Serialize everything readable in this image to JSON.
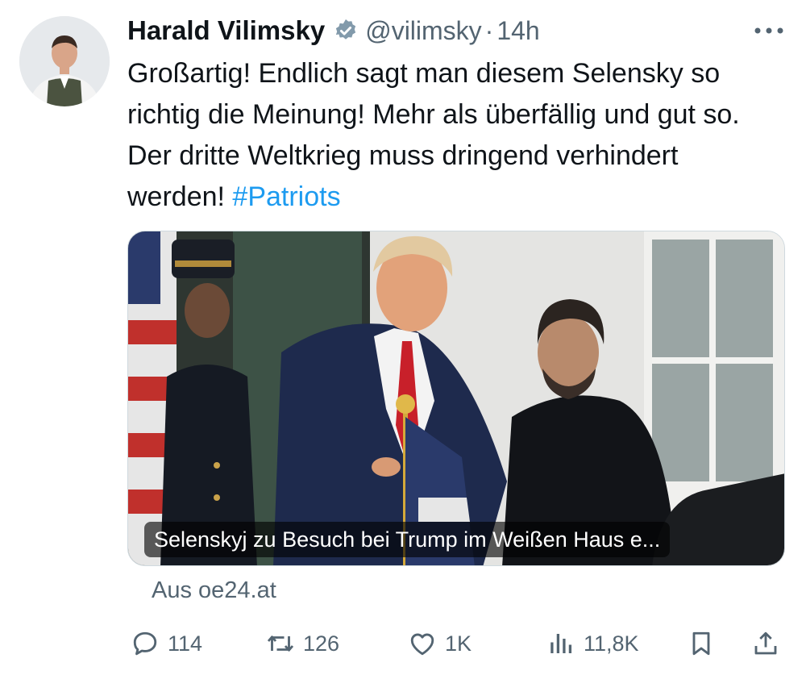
{
  "author": {
    "name": "Harald Vilimsky",
    "handle": "@vilimsky",
    "separator": "·",
    "time": "14h",
    "verified": true
  },
  "tweet": {
    "text": "Großartig! Endlich sagt man diesem Selensky so richtig die Meinung! Mehr als überfällig und gut so. Der dritte Weltkrieg muss dringend verhindert werden! ",
    "hashtag": "#Patriots"
  },
  "media": {
    "caption": "Selenskyj zu Besuch bei Trump im Weißen Haus e...",
    "source": "Aus oe24.at"
  },
  "actions": {
    "replies": "114",
    "reposts": "126",
    "likes": "1K",
    "views": "11,8K"
  },
  "colors": {
    "accent": "#1d9bf0",
    "secondary_text": "#536471",
    "primary_text": "#0f1419"
  },
  "icons": [
    "verified-badge-icon",
    "more-icon",
    "reply-icon",
    "repost-icon",
    "like-icon",
    "views-icon",
    "bookmark-icon",
    "share-icon"
  ]
}
